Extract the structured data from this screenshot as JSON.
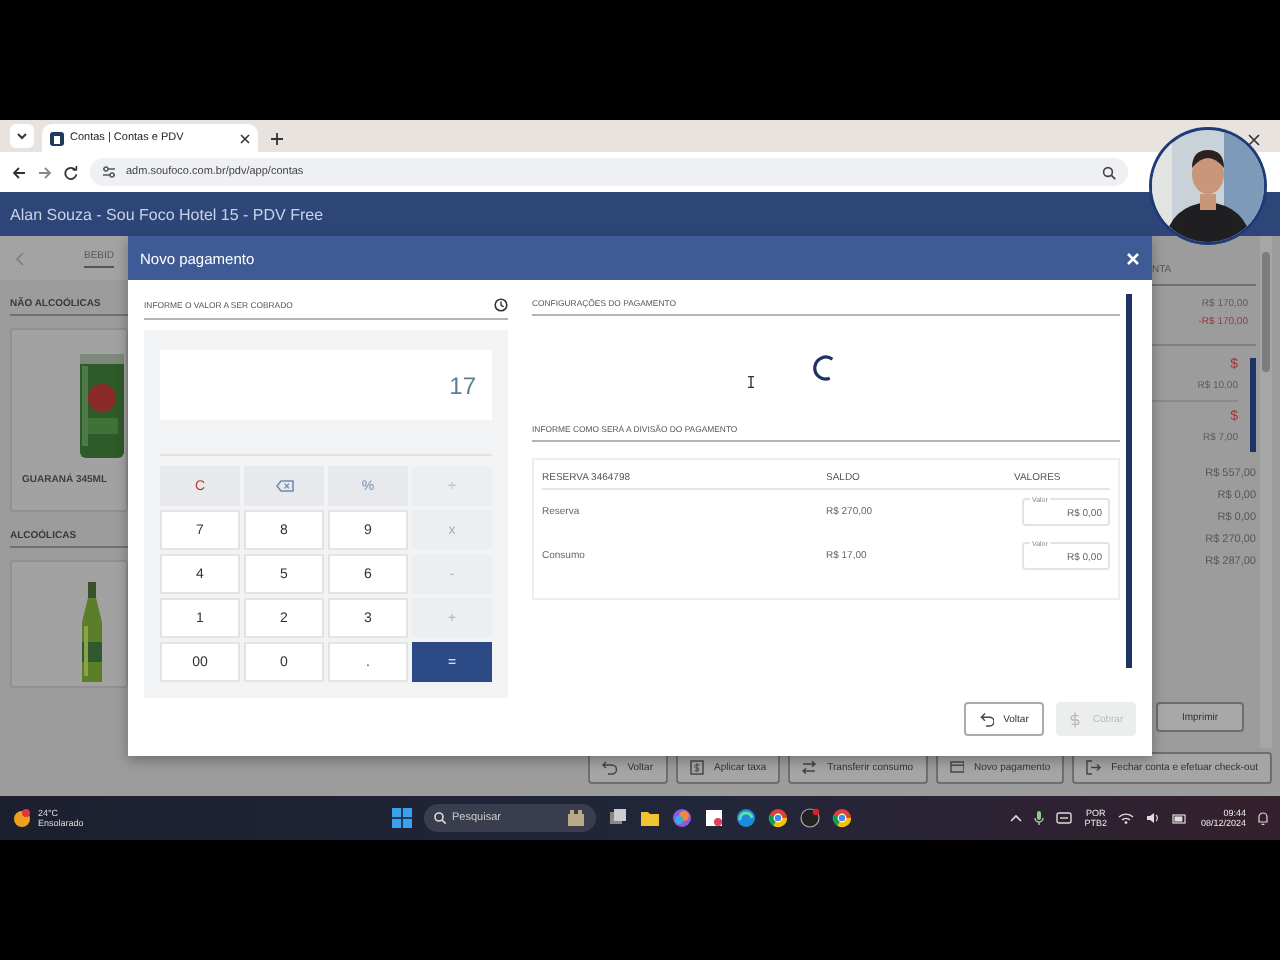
{
  "browser": {
    "tab_title": "Contas | Contas e PDV",
    "address": "adm.soufoco.com.br/pdv/app/contas"
  },
  "app": {
    "header": "Alan Souza - Sou Foco Hotel 15 - PDV Free",
    "left": {
      "tab": "BEBID",
      "categories": [
        {
          "title": "NÃO ALCOÓLICAS",
          "product": {
            "name": "GUARANÁ 345ML",
            "kind": "picture"
          }
        },
        {
          "title": "ALCOÓLICAS"
        }
      ]
    },
    "right": {
      "tab": "NTA",
      "card_1": [
        {
          "text": "R$ 170,00",
          "color": "#5c5c5c"
        },
        {
          "text": "-R$ 170,00",
          "color": "#a3343f"
        }
      ],
      "card_2": [
        {
          "text": "$",
          "color": "#a3343f"
        },
        {
          "text": "R$ 10,00",
          "color": "#5c5c5c"
        },
        {
          "text": "$",
          "color": "#a3343f"
        },
        {
          "text": "R$ 7,00",
          "color": "#5c5c5c"
        }
      ],
      "totals": [
        "R$ 557,00",
        "R$ 0,00",
        "R$ 0,00",
        "R$ 270,00",
        "R$ 287,00"
      ],
      "print_button": "Imprimir"
    },
    "actions": [
      "Voltar",
      "Aplicar taxa",
      "Transferir consumo",
      "Novo pagamento",
      "Fechar conta e efetuar check-out"
    ]
  },
  "modal": {
    "title": "Novo pagamento",
    "amount_heading": "INFORME O VALOR A SER COBRADO",
    "display": "17",
    "keys": [
      {
        "kind": "clear",
        "label": "C"
      },
      {
        "kind": "backspace"
      },
      {
        "kind": "function",
        "label": "%"
      },
      {
        "kind": "operator",
        "label": "÷"
      },
      {
        "kind": "digit",
        "label": "7"
      },
      {
        "kind": "digit",
        "label": "8"
      },
      {
        "kind": "digit",
        "label": "9"
      },
      {
        "kind": "operator",
        "label": "x"
      },
      {
        "kind": "digit",
        "label": "4"
      },
      {
        "kind": "digit",
        "label": "5"
      },
      {
        "kind": "digit",
        "label": "6"
      },
      {
        "kind": "operator",
        "label": "-"
      },
      {
        "kind": "digit",
        "label": "1"
      },
      {
        "kind": "digit",
        "label": "2"
      },
      {
        "kind": "digit",
        "label": "3"
      },
      {
        "kind": "operator",
        "label": "+"
      },
      {
        "kind": "digit",
        "label": "00"
      },
      {
        "kind": "digit",
        "label": "0"
      },
      {
        "kind": "digit",
        "label": "."
      },
      {
        "kind": "equals",
        "label": "="
      }
    ],
    "settings_heading": "CONFIGURAÇÕES DO PAGAMENTO",
    "loading": true,
    "split_heading": "INFORME COMO SERÁ A DIVISÃO DO PAGAMENTO",
    "columns": [
      "RESERVA 3464798",
      "SALDO",
      "VALORES"
    ],
    "rows": [
      {
        "name": "Reserva",
        "balance": "R$ 270,00",
        "field_label": "Valor",
        "value": "R$ 0,00"
      },
      {
        "name": "Consumo",
        "balance": "R$ 17,00",
        "field_label": "Valor",
        "value": "R$ 0,00"
      }
    ],
    "buttons": [
      {
        "label": "Voltar",
        "disabled": false
      },
      {
        "label": "Cobrar",
        "disabled": true
      }
    ]
  },
  "taskbar": {
    "temperature": "24°C",
    "condition": "Ensolarado",
    "search_placeholder": "Pesquisar",
    "language": "POR",
    "layout": "PTB2",
    "time": "09:44",
    "date": "08/12/2024"
  }
}
